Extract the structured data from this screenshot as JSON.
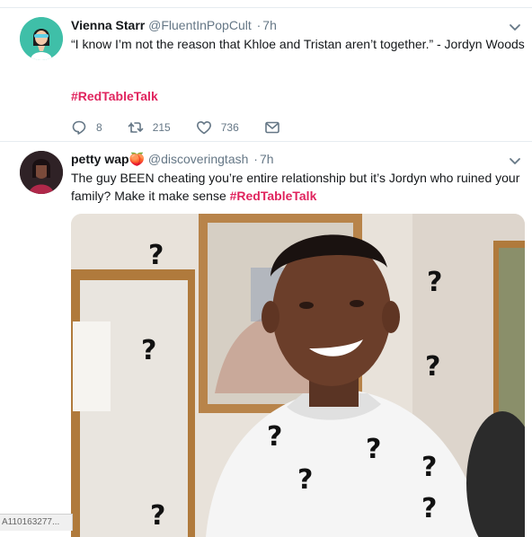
{
  "tweets": [
    {
      "name": "Vienna Starr",
      "handle": "@FluentInPopCult",
      "separator": "·",
      "time": "7h",
      "text": "“I know I’m not the reason that Khloe and Tristan aren’t together.” - Jordyn Woods",
      "hashtag": "#RedTableTalk",
      "replies": "8",
      "retweets": "215",
      "likes": "736"
    },
    {
      "name": "petty wap",
      "name_emoji": "🍑",
      "handle": "@discoveringtash",
      "separator": "·",
      "time": "7h",
      "text": "The guy BEEN cheating you’re entire relationship but it’s Jordyn who ruined your family? Make it make sense",
      "hashtag": "#RedTableTalk",
      "media_marks": [
        "?",
        "?",
        "?",
        "?",
        "?",
        "?",
        "?",
        "?",
        "?",
        "?"
      ]
    }
  ],
  "footer": {
    "id_text": "A110163277..."
  },
  "colors": {
    "hashtag": "#e0245e",
    "secondary": "#657786",
    "border": "#e6ecf0"
  }
}
